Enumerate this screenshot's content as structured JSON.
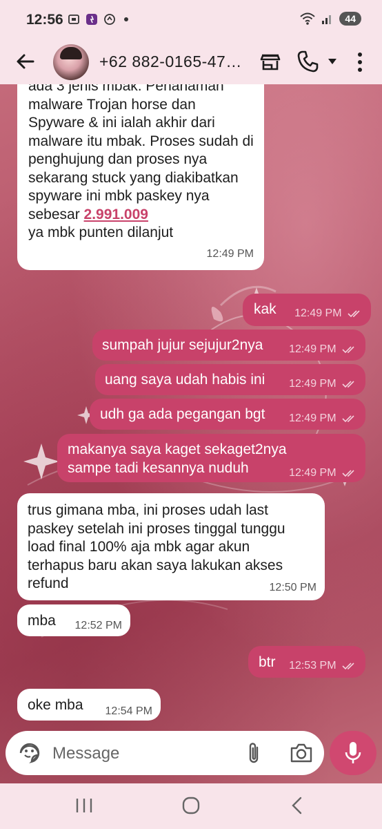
{
  "status_bar": {
    "time": "12:56",
    "battery": "44",
    "icons": [
      "screenshot-icon",
      "app-notification-icon",
      "sync-icon",
      "dot",
      "wifi-icon",
      "signal-icon"
    ]
  },
  "header": {
    "contact_name": "+62 882-0165-47…",
    "icons": [
      "back-arrow-icon",
      "store-icon",
      "phone-icon",
      "dropdown-caret-icon",
      "more-vert-icon"
    ]
  },
  "messages": [
    {
      "direction": "incoming",
      "text_before": "ada 3 jenis mbak. Penanaman malware Trojan horse dan Spyware & ini ialah akhir dari malware itu mbak. Proses sudah di penghujung dan proses nya sekarang stuck yang diakibatkan spyware ini mbk paskey nya sebesar ",
      "link": "2.991.009",
      "text_after": "ya mbk punten dilanjut",
      "time": "12:49 PM"
    },
    {
      "direction": "outgoing",
      "text": "kak",
      "time": "12:49 PM",
      "read": true
    },
    {
      "direction": "outgoing",
      "text": "sumpah jujur sejujur2nya",
      "time": "12:49 PM",
      "read": true
    },
    {
      "direction": "outgoing",
      "text": "uang saya udah habis ini",
      "time": "12:49 PM",
      "read": true
    },
    {
      "direction": "outgoing",
      "text": "udh ga ada pegangan bgt",
      "time": "12:49 PM",
      "read": true
    },
    {
      "direction": "outgoing",
      "text": "makanya saya kaget sekaget2nya sampe tadi kesannya nuduh",
      "time": "12:49 PM",
      "read": true
    },
    {
      "direction": "incoming",
      "text": "trus gimana mba, ini proses udah last paskey setelah ini proses tinggal tunggu load final 100% aja mbk agar akun terhapus baru akan saya lakukan akses refund",
      "time": "12:50 PM"
    },
    {
      "direction": "incoming",
      "text": "mba",
      "time": "12:52 PM"
    },
    {
      "direction": "outgoing",
      "text": "btr",
      "time": "12:53 PM",
      "read": true
    },
    {
      "direction": "incoming",
      "text": "oke mba",
      "time": "12:54 PM"
    }
  ],
  "composer": {
    "placeholder": "Message",
    "icons": [
      "emoji-sticker-icon",
      "attachment-icon",
      "camera-icon",
      "microphone-icon"
    ]
  },
  "nav_bar": {
    "icons": [
      "recent-apps-icon",
      "home-icon",
      "back-icon"
    ]
  },
  "colors": {
    "outgoing_bubble": "#c8426a",
    "incoming_bubble": "#ffffff",
    "header_bg": "#f8e4ea",
    "mic_button": "#d04870"
  }
}
